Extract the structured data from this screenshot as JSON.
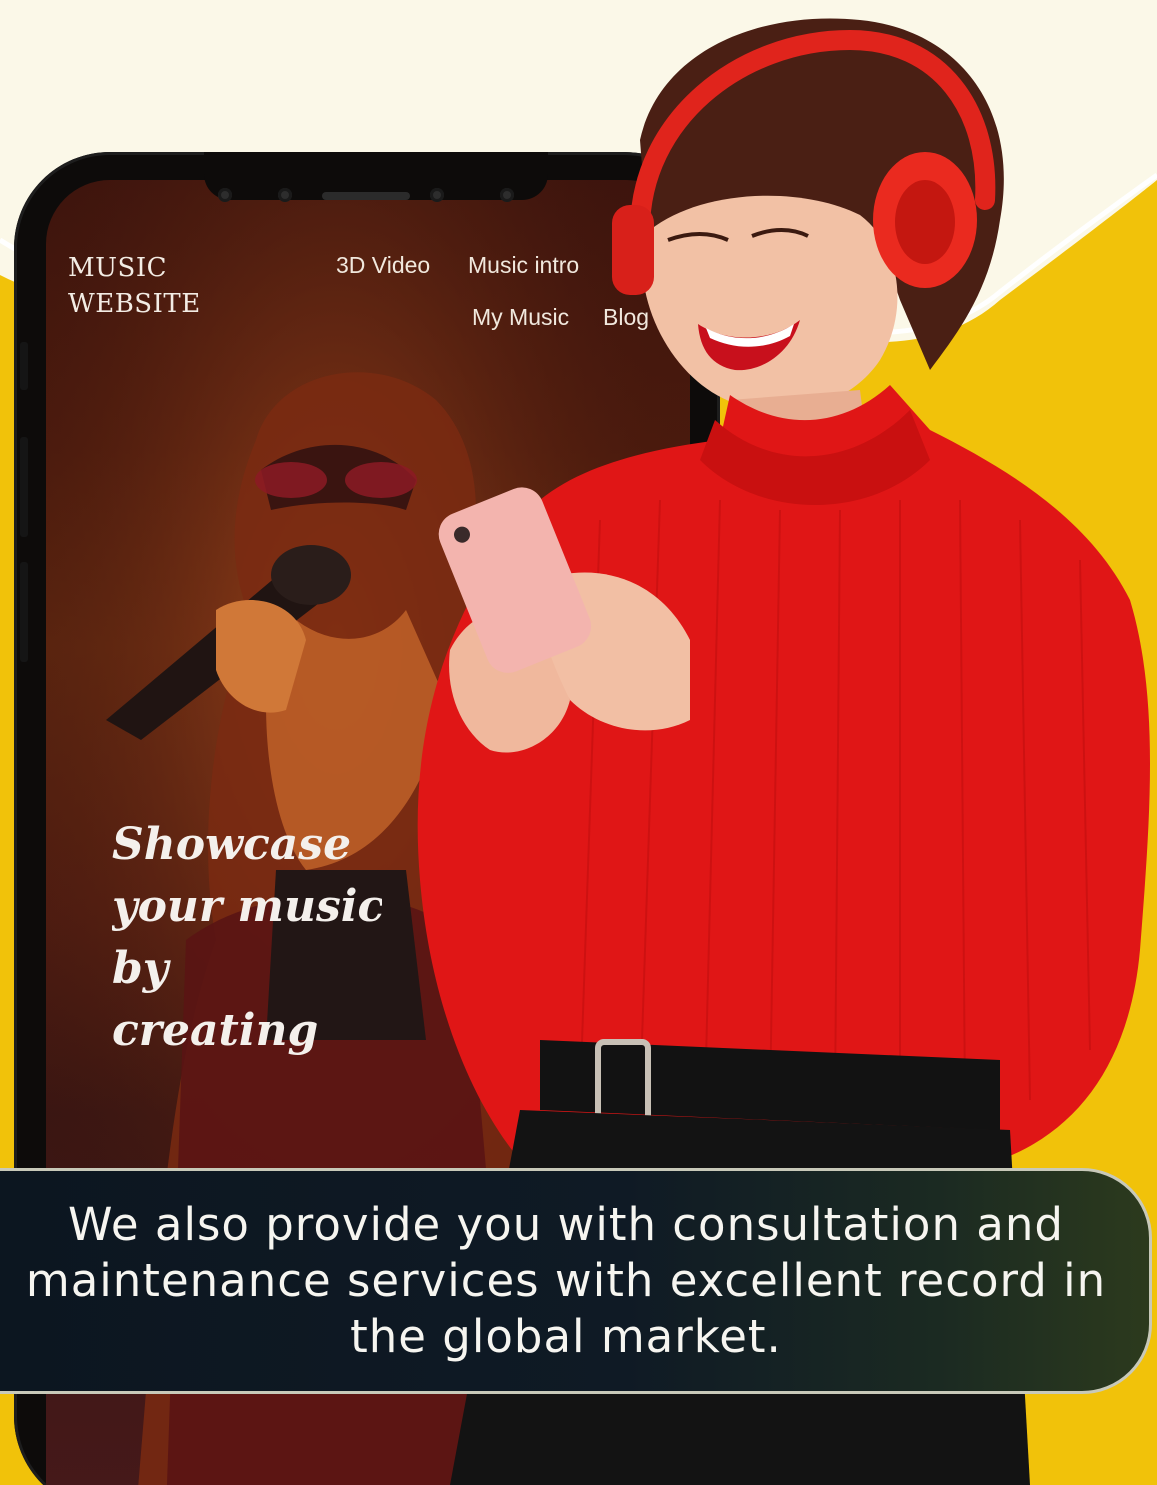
{
  "site": {
    "logo_line1": "MUSIC",
    "logo_line2": "WEBSITE",
    "nav": {
      "item1": "3D Video",
      "item2": "Music intro",
      "item3": "My Music",
      "item4": "Blog"
    }
  },
  "hero": {
    "line1": "Showcase",
    "line2": "your music",
    "line3": "by",
    "line4": "creating"
  },
  "banner": {
    "text": "We also provide you with consultation and maintenance services with excellent record in the global market."
  },
  "colors": {
    "background_cream": "#fbf8e8",
    "accent_yellow": "#f1c20a",
    "sweater_red": "#e01616",
    "headphones_red": "#ea2a1f",
    "banner_dark": "#0f1a25"
  },
  "icons": {
    "phone_camera": "camera-icon",
    "phone_speaker": "speaker-grille-icon"
  }
}
